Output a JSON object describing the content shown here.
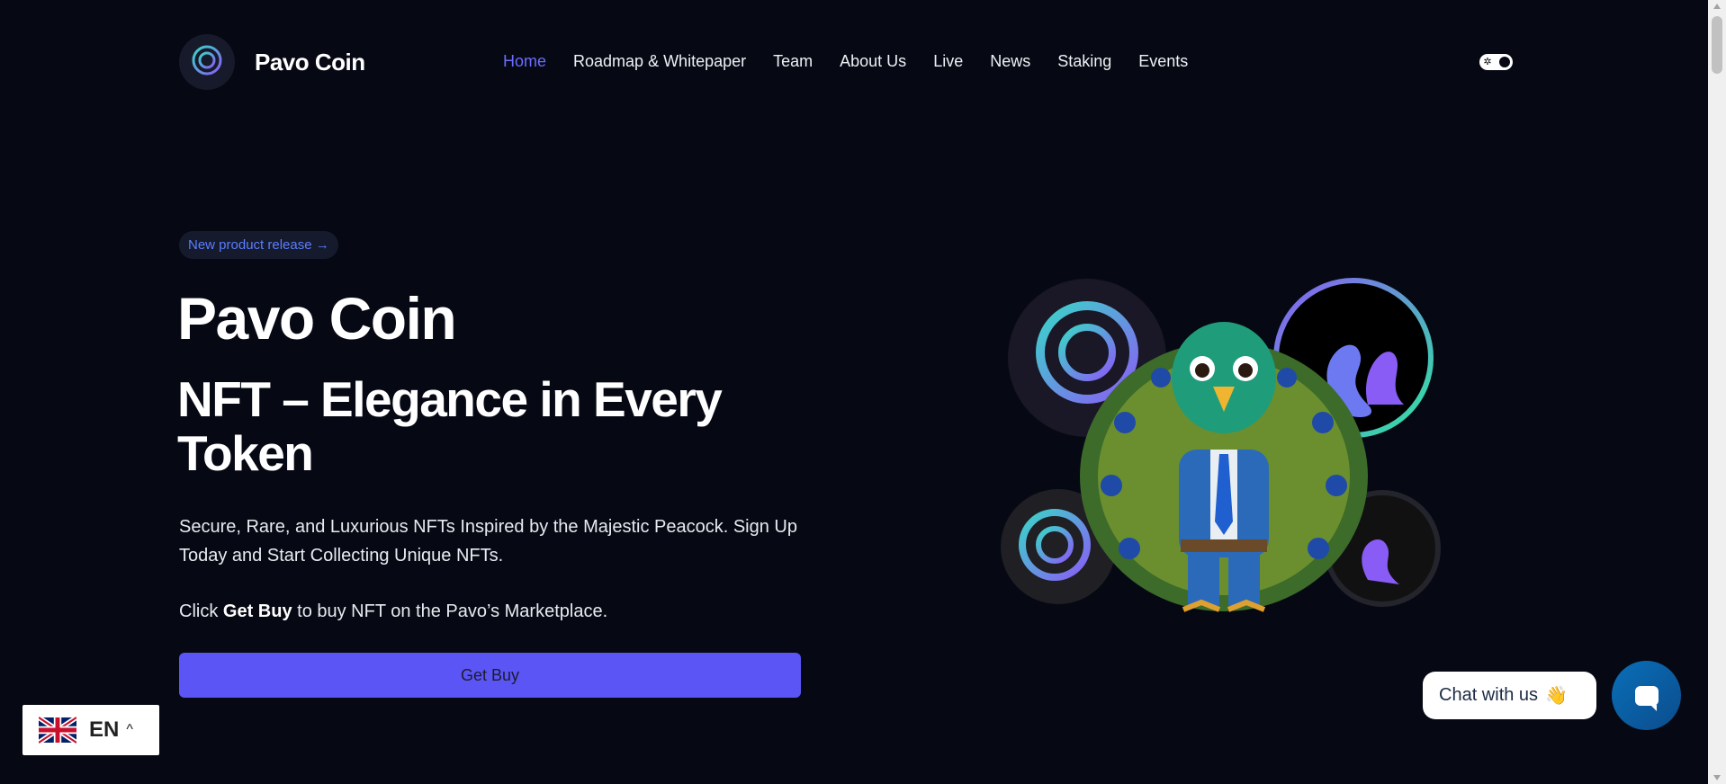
{
  "header": {
    "brand": "Pavo Coin",
    "nav": [
      {
        "label": "Home",
        "active": true
      },
      {
        "label": "Roadmap & Whitepaper",
        "active": false
      },
      {
        "label": "Team",
        "active": false
      },
      {
        "label": "About Us",
        "active": false
      },
      {
        "label": "Live",
        "active": false
      },
      {
        "label": "News",
        "active": false
      },
      {
        "label": "Staking",
        "active": false
      },
      {
        "label": "Events",
        "active": false
      }
    ],
    "theme_toggle_icon": "sun-icon"
  },
  "hero": {
    "badge": "New product release →",
    "title": "Pavo Coin",
    "subtitle": "NFT – Elegance in Every Token",
    "description": "Secure, Rare, and Luxurious NFTs Inspired by the Majestic Peacock. Sign Up Today and Start Collecting Unique NFTs.",
    "click_prefix": "Click ",
    "click_bold": "Get Buy",
    "click_suffix": " to buy NFT on the Pavo’s Marketplace.",
    "button_label": "Get Buy"
  },
  "language": {
    "code": "EN",
    "flag_icon": "uk-flag-icon",
    "caret_icon": "chevron-up-icon"
  },
  "chat": {
    "label": "Chat with us",
    "emoji": "👋",
    "button_icon": "chat-bubble-icon"
  },
  "colors": {
    "background": "#060913",
    "accent": "#5b55f5",
    "nav_active": "#6a6cff",
    "chat_button": "#0a6fb8"
  }
}
